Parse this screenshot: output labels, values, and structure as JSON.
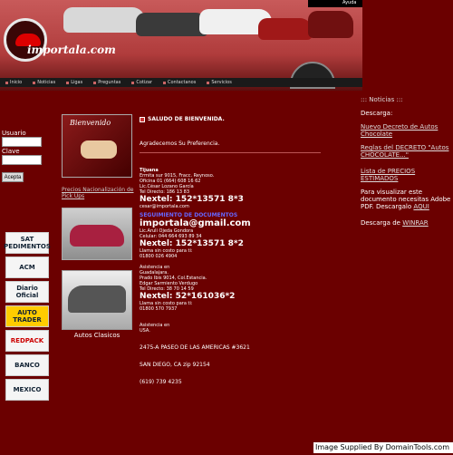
{
  "header": {
    "logo_text": "importala.com",
    "top_link": "Ayuda",
    "nav": [
      "Inicio",
      "Noticias",
      "Ligas",
      "Preguntas",
      "Cotizar",
      "Contactanos",
      "Servicios"
    ]
  },
  "login": {
    "user_label": "Usuario",
    "key_label": "Clave",
    "button": "Acepta"
  },
  "logos": [
    "SAT PEDIMENTOS",
    "ACM",
    "Diario Oficial",
    "AUTO TRADER",
    "REDPACK",
    "BANCO",
    "MEXICO"
  ],
  "left_col": {
    "welcome_photo_text": "Bienvenido",
    "precios_link": "Precios Nacionalización de Pick Ups",
    "photo_caption": "Autos Clasicos"
  },
  "center": {
    "welcome": "SALUDO DE BIENVENIDA.",
    "thanks": "Agradecemos Su Preferencia.",
    "tijuana_block": [
      "Tijuana",
      "Ermita sur 9015, Fracc. Reynoso.",
      "Oficina 01 (664) 608 16 62",
      "Lic.César Lozano García",
      "Tel Directo: 186 13 83"
    ],
    "nextel1": "Nextel: 152*13571 8*3",
    "email1": "cesar@importala.com",
    "email_blue": "SEGUIMIENTO DE DOCUMENTOS",
    "email2": "importala@gmail.com",
    "mid_block": [
      "Lic.Aruli Ojeda Gondora",
      "Celular: 044 664 693 89 34"
    ],
    "nextel2": "Nextel: 152*13571 8*2",
    "free_call1": [
      "Llama sin costo para ti:",
      "01800 026 4904"
    ],
    "gdl_block": [
      "Asistencia en",
      "Guadalajara.",
      "Prado Ibis 9014, Col.Estancia.",
      "Edgar Sarmiento Verdugo",
      "Tel Directo: 38 70 14 59"
    ],
    "nextel3": "Nextel: 52*161036*2",
    "free_call2": [
      "Llama sin costo para ti:",
      "01800 570 7937"
    ],
    "usa_block": [
      "Asistencia en",
      "USA."
    ],
    "address1": "2475-A PASEO DE LAS AMERICAS #3621",
    "address2": "SAN DIEGO, CA zip 92154",
    "phone": "(619) 739 4235"
  },
  "right": {
    "title": "::: Noticias :::",
    "descarga": "Descarga:",
    "decreto_link": "Nuevo Decreto de Autos Chocolate",
    "reglas_link": "Reglas del DECRETO \"Autos CHOCOLATE...\"",
    "lista_link": "Lista de PRECIOS ESTIMADOS",
    "visualizar": "Para visualizar este documento necesitas Adobe PDF. Descargalo",
    "aqui": "AQUI",
    "winrar_pre": "Descarga de",
    "winrar": "WINRAR"
  },
  "footer": "Image Supplied By DomainTools.com"
}
